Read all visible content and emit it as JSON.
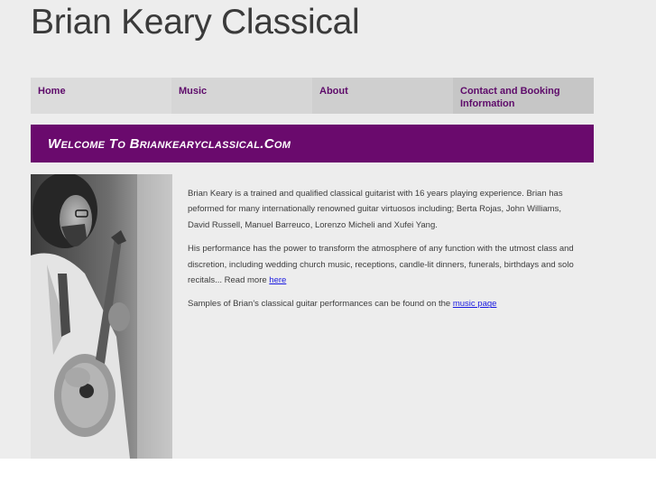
{
  "site": {
    "title": "Brian Keary Classical"
  },
  "nav": {
    "items": [
      {
        "label": "Home"
      },
      {
        "label": "Music"
      },
      {
        "label": "About"
      },
      {
        "label": "Contact and Booking Information"
      }
    ]
  },
  "banner": {
    "text": "Welcome To Briankearyclassical.Com"
  },
  "photo": {
    "alt": ""
  },
  "content": {
    "p1": "Brian Keary is a trained and qualified classical guitarist with 16 years playing experience. Brian has peformed for many internationally renowned guitar virtuosos including; Berta Rojas, John Williams, David Russell, Manuel Barreuco, Lorenzo Micheli and Xufei Yang.",
    "p2_text": "His performance has the power to transform the atmosphere of any function with the utmost class and discretion, including wedding church music, receptions, candle-lit dinners, funerals, birthdays and solo recitals... Read more ",
    "p2_link": "here",
    "p3_text": "Samples of Brian's classical guitar performances can be found on the ",
    "p3_link": "music page"
  },
  "colors": {
    "accent": "#6a0a6d",
    "nav_text": "#5e0b6a",
    "link": "#1a1ae0",
    "page_background": "#ededed"
  }
}
